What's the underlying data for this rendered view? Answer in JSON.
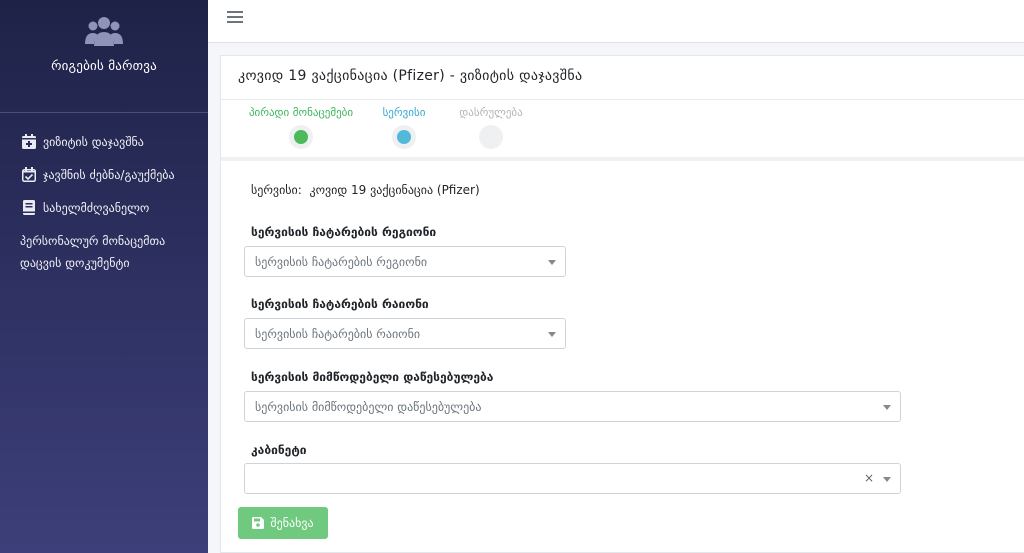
{
  "sidebar": {
    "brand_name": "რიგების მართვა",
    "brand_icon": "users-group-icon",
    "items": [
      {
        "label": "ვიზიტის დაჯავშნა",
        "icon": "calendar-plus-icon"
      },
      {
        "label": "ჯავშნის ძებნა/გაუქმება",
        "icon": "calendar-check-icon"
      },
      {
        "label": "სახელმძღვანელო",
        "icon": "book-icon"
      },
      {
        "label": "პერსონალურ მონაცემთა დაცვის დოკუმენტი",
        "icon": ""
      }
    ]
  },
  "topbar": {
    "menu_icon": "hamburger-icon"
  },
  "card": {
    "title": "კოვიდ 19 ვაქცინაცია (Pfizer) - ვიზიტის დაჯავშნა",
    "steps": [
      {
        "label": "პირადი მონაცემები",
        "status": "completed",
        "color": "#4cba5a"
      },
      {
        "label": "სერვისი",
        "status": "active",
        "color": "#52b9d9"
      },
      {
        "label": "დასრულება",
        "status": "pending",
        "color": "#eef0f2"
      }
    ],
    "service_prefix": "სერვისი:",
    "service_value": "კოვიდ 19 ვაქცინაცია (Pfizer)",
    "fields": [
      {
        "label": "სერვისის ჩატარების რეგიონი",
        "placeholder": "სერვისის ჩატარების რეგიონი"
      },
      {
        "label": "სერვისის ჩატარების რაიონი",
        "placeholder": "სერვისის ჩატარების რაიონი"
      },
      {
        "label": "სერვისის მიმწოდებელი დაწესებულება",
        "placeholder": "სერვისის მიმწოდებელი დაწესებულება"
      },
      {
        "label": "კაბინეტი",
        "placeholder": "",
        "clear": "×"
      }
    ],
    "save_label": "შენახვა",
    "accent_color": "#6fc97e"
  }
}
